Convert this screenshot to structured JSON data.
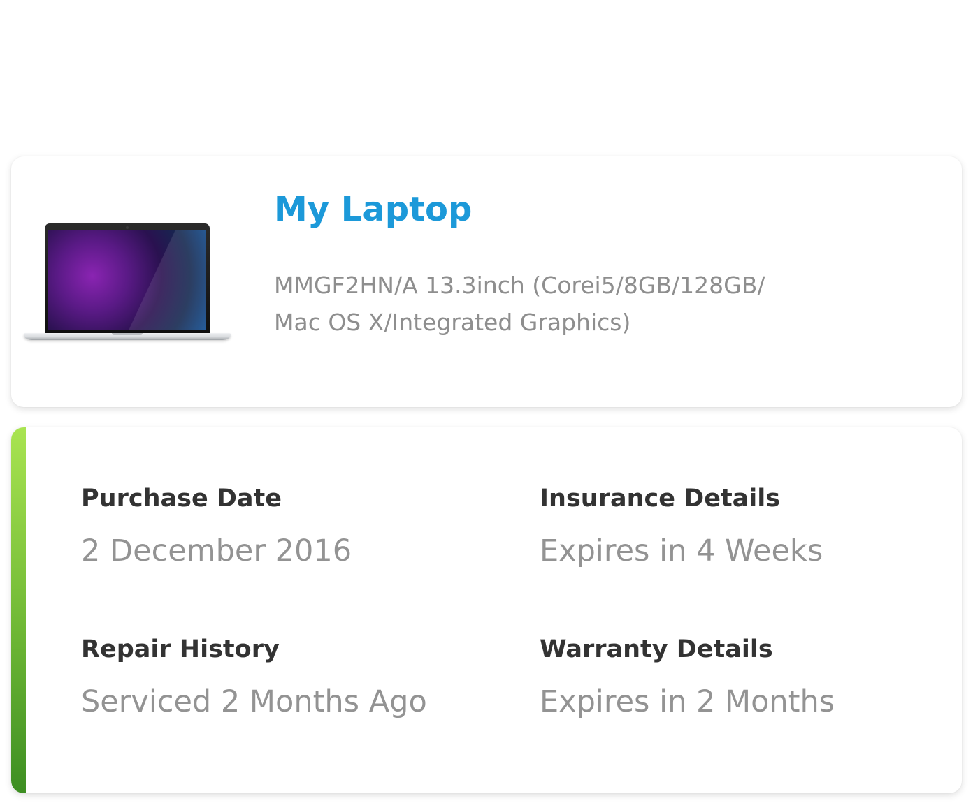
{
  "device": {
    "name": "My Laptop",
    "specs_line1": "MMGF2HN/A 13.3inch (Corei5/8GB/128GB/",
    "specs_line2": "Mac OS X/Integrated Graphics)",
    "image": "laptop-image"
  },
  "details": {
    "purchase_date": {
      "label": "Purchase Date",
      "value": "2 December 2016"
    },
    "insurance": {
      "label": "Insurance Details",
      "value": "Expires in 4 Weeks"
    },
    "repair": {
      "label": "Repair History",
      "value": "Serviced 2 Months Ago"
    },
    "warranty": {
      "label": "Warranty Details",
      "value": "Expires in 2 Months"
    }
  },
  "colors": {
    "title": "#1c99d9",
    "label": "#333333",
    "value": "#939393",
    "accent_top": "#a9e451",
    "accent_bottom": "#3d8e22"
  }
}
